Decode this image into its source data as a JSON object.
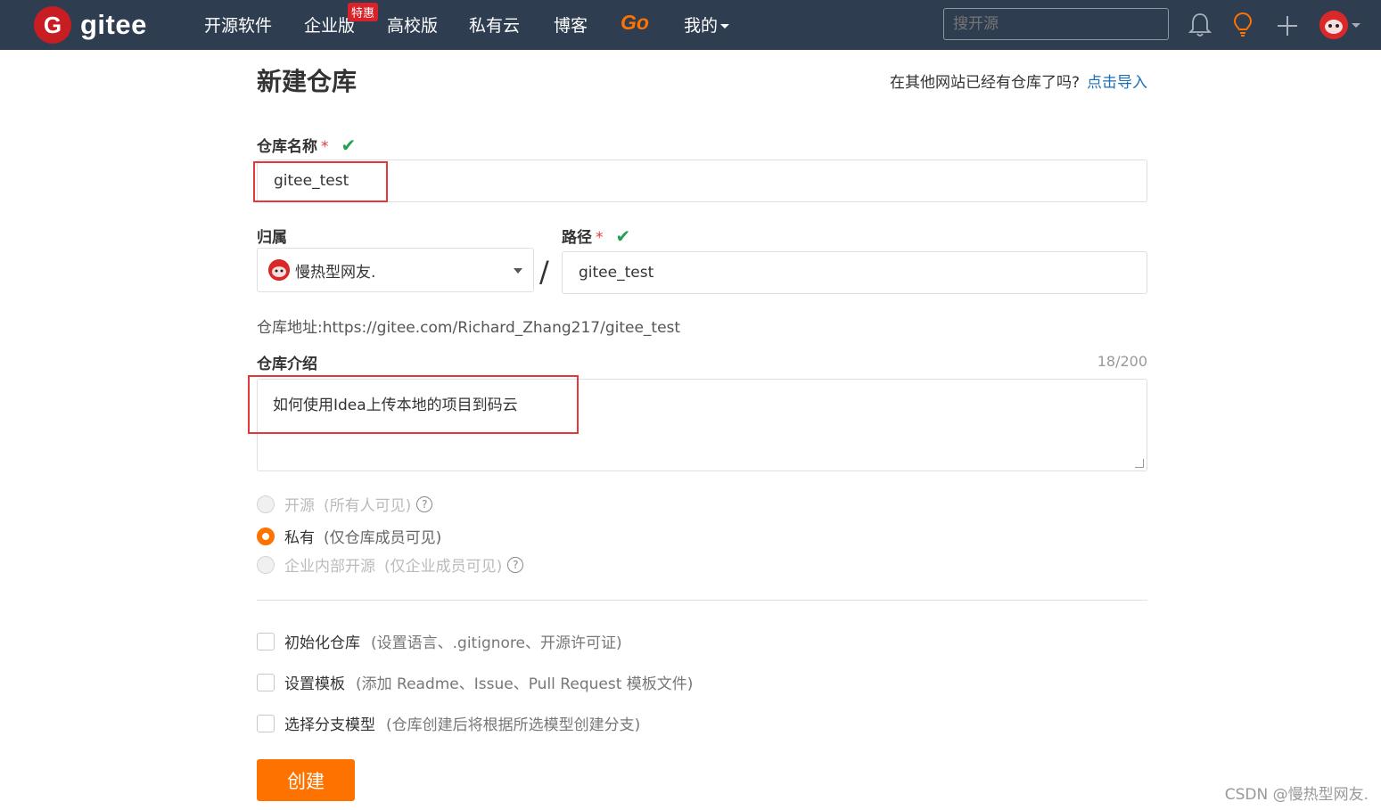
{
  "nav": {
    "logo_letter": "G",
    "logo_text": "gitee",
    "items": [
      "开源软件",
      "企业版",
      "高校版",
      "私有云",
      "博客"
    ],
    "badge": "特惠",
    "go": "Go",
    "mine": "我的",
    "search_placeholder": "搜开源"
  },
  "page": {
    "title": "新建仓库",
    "import_prompt": "在其他网站已经有仓库了吗?",
    "import_link": "点击导入"
  },
  "form": {
    "repo_name_label": "仓库名称",
    "required_mark": "*",
    "check_mark": "✔",
    "repo_name_value": "gitee_test",
    "owner_label": "归属",
    "owner_value": "慢热型网友.",
    "path_label": "路径",
    "path_value": "gitee_test",
    "slash": "/",
    "address": "仓库地址:https://gitee.com/Richard_Zhang217/gitee_test",
    "desc_label": "仓库介绍",
    "desc_counter": "18/200",
    "desc_value": "如何使用Idea上传本地的项目到码云"
  },
  "visibility": [
    {
      "label": "开源",
      "sub": "(所有人可见)",
      "help": "?"
    },
    {
      "label": "私有",
      "sub": "(仅仓库成员可见)"
    },
    {
      "label": "企业内部开源",
      "sub": "(仅企业成员可见)",
      "help": "?"
    }
  ],
  "options": [
    {
      "label": "初始化仓库",
      "sub": "(设置语言、.gitignore、开源许可证)"
    },
    {
      "label": "设置模板",
      "sub": "(添加 Readme、Issue、Pull Request 模板文件)"
    },
    {
      "label": "选择分支模型",
      "sub": "(仓库创建后将根据所选模型创建分支)"
    }
  ],
  "create_button": "创建",
  "watermark": "CSDN @慢热型网友.",
  "colors": {
    "nav_bg": "#2e3e50",
    "brand_red": "#c71d23",
    "accent_orange": "#fe7300",
    "link_blue": "#1e6fb7",
    "success_green": "#21a250",
    "highlight_box": "#e5383b"
  }
}
